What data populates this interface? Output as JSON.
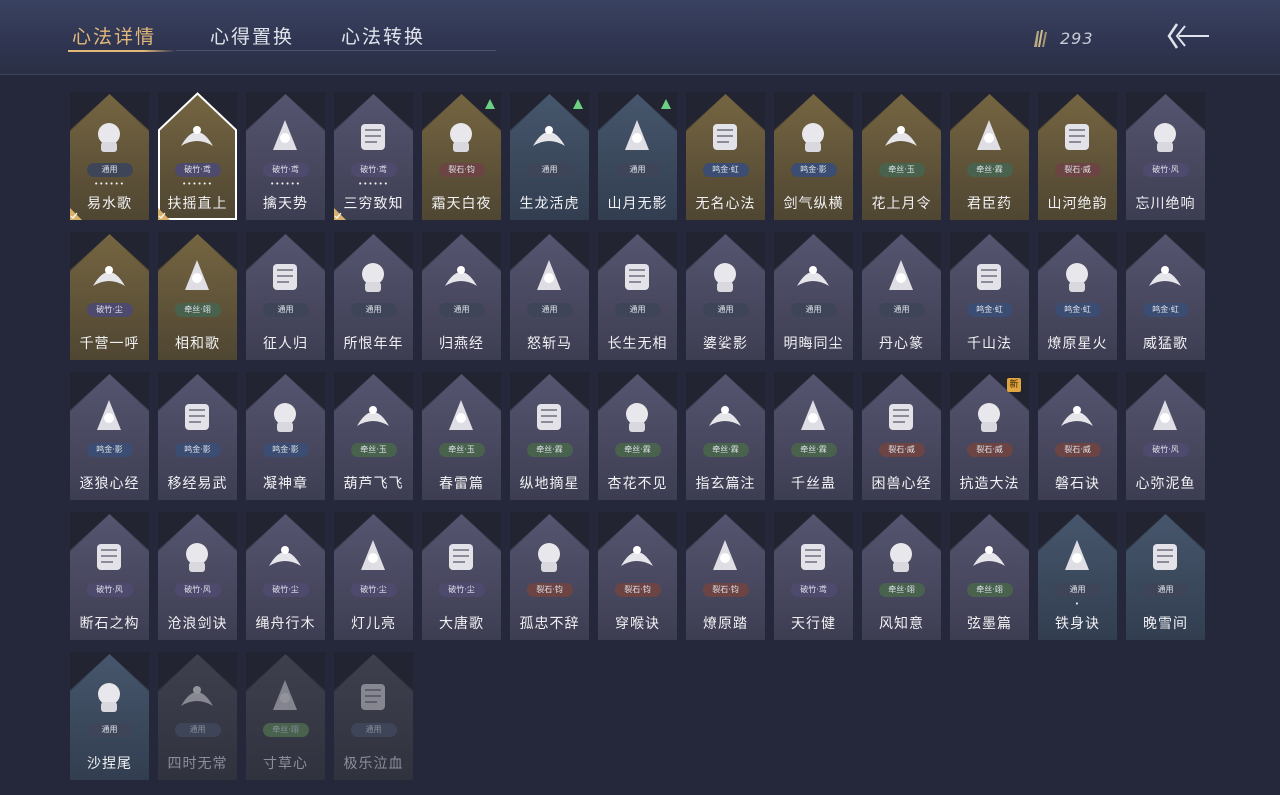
{
  "tabs": [
    {
      "label": "心法详情",
      "active": true
    },
    {
      "label": "心得置换",
      "active": false
    },
    {
      "label": "心法转换",
      "active": false
    }
  ],
  "currency": {
    "icon": "feather-quill-icon",
    "amount": "293"
  },
  "back_icon": "back-arrow-icon",
  "colors": {
    "gold_card": "#675a3a",
    "purple_card": "#4c4a62",
    "blue_card": "#3a4a5e",
    "dark_card": "#3a3c4a",
    "accent": "#e2b77a",
    "upgrade_arrow": "#6bd084",
    "new_tag": "#e0a440"
  },
  "cards": [
    {
      "name": "易水歌",
      "school": "通用",
      "tone": "gold",
      "dots": "••••••",
      "corner": true,
      "icon": "horse-icon"
    },
    {
      "name": "扶摇直上",
      "school": "破竹·鸢",
      "tone": "gold",
      "dots": "••••••",
      "corner": true,
      "selected": true,
      "icon": "eagle-icon"
    },
    {
      "name": "擒天势",
      "school": "破竹·鸢",
      "tone": "purple",
      "dots": "••••••",
      "icon": "chain-fist-icon"
    },
    {
      "name": "三穷致知",
      "school": "破竹·鸢",
      "tone": "purple",
      "dots": "••••••",
      "corner": true,
      "icon": "scroll-icon"
    },
    {
      "name": "霜天白夜",
      "school": "裂石·钧",
      "tone": "gold",
      "up": true,
      "icon": "spear-icon"
    },
    {
      "name": "生龙活虎",
      "school": "通用",
      "tone": "blue",
      "up": true,
      "icon": "tiger-swirl-icon"
    },
    {
      "name": "山月无影",
      "school": "通用",
      "tone": "blue",
      "up": true,
      "icon": "blade-icon"
    },
    {
      "name": "无名心法",
      "school": "鸣金·虹",
      "tone": "gold",
      "icon": "sword-icon"
    },
    {
      "name": "剑气纵横",
      "school": "鸣金·影",
      "tone": "gold",
      "icon": "sword-swirl-icon"
    },
    {
      "name": "花上月令",
      "school": "牵丝·玉",
      "tone": "gold",
      "icon": "flower-icon"
    },
    {
      "name": "君臣药",
      "school": "牵丝·霖",
      "tone": "gold",
      "icon": "gourd-pour-icon"
    },
    {
      "name": "山河绝韵",
      "school": "裂石·威",
      "tone": "gold",
      "icon": "mountain-icon"
    },
    {
      "name": "忘川绝响",
      "school": "破竹·风",
      "tone": "purple",
      "icon": "mask-icon"
    },
    {
      "name": "千营一呼",
      "school": "破竹·尘",
      "tone": "gold",
      "icon": "banner-icon"
    },
    {
      "name": "相和歌",
      "school": "牵丝·翊",
      "tone": "gold",
      "icon": "heart-bird-icon"
    },
    {
      "name": "征人归",
      "school": "通用",
      "tone": "purple",
      "icon": "hands-bird-icon"
    },
    {
      "name": "所恨年年",
      "school": "通用",
      "tone": "purple",
      "icon": "willow-icon"
    },
    {
      "name": "归燕经",
      "school": "通用",
      "tone": "purple",
      "icon": "swallow-icon"
    },
    {
      "name": "怒斩马",
      "school": "通用",
      "tone": "purple",
      "icon": "glaive-icon"
    },
    {
      "name": "长生无相",
      "school": "通用",
      "tone": "purple",
      "icon": "figure-icon"
    },
    {
      "name": "婆娑影",
      "school": "通用",
      "tone": "purple",
      "icon": "dragon-icon"
    },
    {
      "name": "明晦同尘",
      "school": "通用",
      "tone": "purple",
      "icon": "snake-sword-icon"
    },
    {
      "name": "丹心篆",
      "school": "通用",
      "tone": "purple",
      "icon": "stamp-icon"
    },
    {
      "name": "千山法",
      "school": "鸣金·虹",
      "tone": "purple",
      "icon": "peaks-icon"
    },
    {
      "name": "燎原星火",
      "school": "鸣金·虹",
      "tone": "purple",
      "icon": "scythe-icon"
    },
    {
      "name": "威猛歌",
      "school": "鸣金·虹",
      "tone": "purple",
      "icon": "praying-hands-icon"
    },
    {
      "name": "逐狼心经",
      "school": "鸣金·影",
      "tone": "purple",
      "icon": "wolf-icon"
    },
    {
      "name": "移经易武",
      "school": "鸣金·影",
      "tone": "purple",
      "icon": "armor-icon"
    },
    {
      "name": "凝神章",
      "school": "鸣金·影",
      "tone": "purple",
      "icon": "bow-icon"
    },
    {
      "name": "葫芦飞飞",
      "school": "牵丝·玉",
      "tone": "purple",
      "icon": "gourds-icon"
    },
    {
      "name": "春雷篇",
      "school": "牵丝·玉",
      "tone": "purple",
      "icon": "lightning-icon"
    },
    {
      "name": "纵地摘星",
      "school": "牵丝·霖",
      "tone": "purple",
      "icon": "orbit-icon"
    },
    {
      "name": "杏花不见",
      "school": "牵丝·霖",
      "tone": "purple",
      "icon": "blossom-icon"
    },
    {
      "name": "指玄篇注",
      "school": "牵丝·霖",
      "tone": "purple",
      "icon": "yinyang-icon"
    },
    {
      "name": "千丝蛊",
      "school": "牵丝·霖",
      "tone": "purple",
      "icon": "leaf-icon"
    },
    {
      "name": "困兽心经",
      "school": "裂石·威",
      "tone": "purple",
      "icon": "drum-icon"
    },
    {
      "name": "抗造大法",
      "school": "裂石·威",
      "tone": "purple",
      "new": true,
      "icon": "bell-icon"
    },
    {
      "name": "磐石诀",
      "school": "裂石·威",
      "tone": "purple",
      "icon": "rock-icon"
    },
    {
      "name": "心弥泥鱼",
      "school": "破竹·风",
      "tone": "purple",
      "icon": "fish-icon"
    },
    {
      "name": "断石之构",
      "school": "破竹·风",
      "tone": "purple",
      "icon": "warrior-icon"
    },
    {
      "name": "沧浪剑诀",
      "school": "破竹·风",
      "tone": "purple",
      "icon": "serpent-icon"
    },
    {
      "name": "绳舟行木",
      "school": "破竹·尘",
      "tone": "purple",
      "icon": "tree-icon"
    },
    {
      "name": "灯儿亮",
      "school": "破竹·尘",
      "tone": "purple",
      "icon": "lamp-icon"
    },
    {
      "name": "大唐歌",
      "school": "破竹·尘",
      "tone": "purple",
      "icon": "city-icon"
    },
    {
      "name": "孤忠不辞",
      "school": "裂石·钧",
      "tone": "purple",
      "icon": "crossed-blades-icon"
    },
    {
      "name": "穿喉诀",
      "school": "裂石·钧",
      "tone": "purple",
      "icon": "moon-spear-icon"
    },
    {
      "name": "燎原踏",
      "school": "裂石·钧",
      "tone": "purple",
      "icon": "rider-icon"
    },
    {
      "name": "天行健",
      "school": "破竹·鸢",
      "tone": "purple",
      "icon": "hat-icon"
    },
    {
      "name": "风知意",
      "school": "牵丝·翊",
      "tone": "purple",
      "icon": "fan-icon"
    },
    {
      "name": "弦墨篇",
      "school": "牵丝·翊",
      "tone": "purple",
      "icon": "brush-icon"
    },
    {
      "name": "铁身诀",
      "school": "通用",
      "tone": "blue",
      "dots": "•",
      "icon": "strongman-icon"
    },
    {
      "name": "晚雪间",
      "school": "通用",
      "tone": "blue",
      "icon": "cross-icon"
    },
    {
      "name": "沙捏尾",
      "school": "通用",
      "tone": "blue",
      "icon": "wave-icon"
    },
    {
      "name": "四时无常",
      "school": "通用",
      "tone": "dark",
      "dim": true,
      "icon": "cat-icon"
    },
    {
      "name": "寸草心",
      "school": "牵丝·翊",
      "tone": "dark",
      "dim": true,
      "icon": "lock-icon"
    },
    {
      "name": "极乐泣血",
      "school": "通用",
      "tone": "dark",
      "dim": true,
      "icon": "ring-icon"
    }
  ]
}
